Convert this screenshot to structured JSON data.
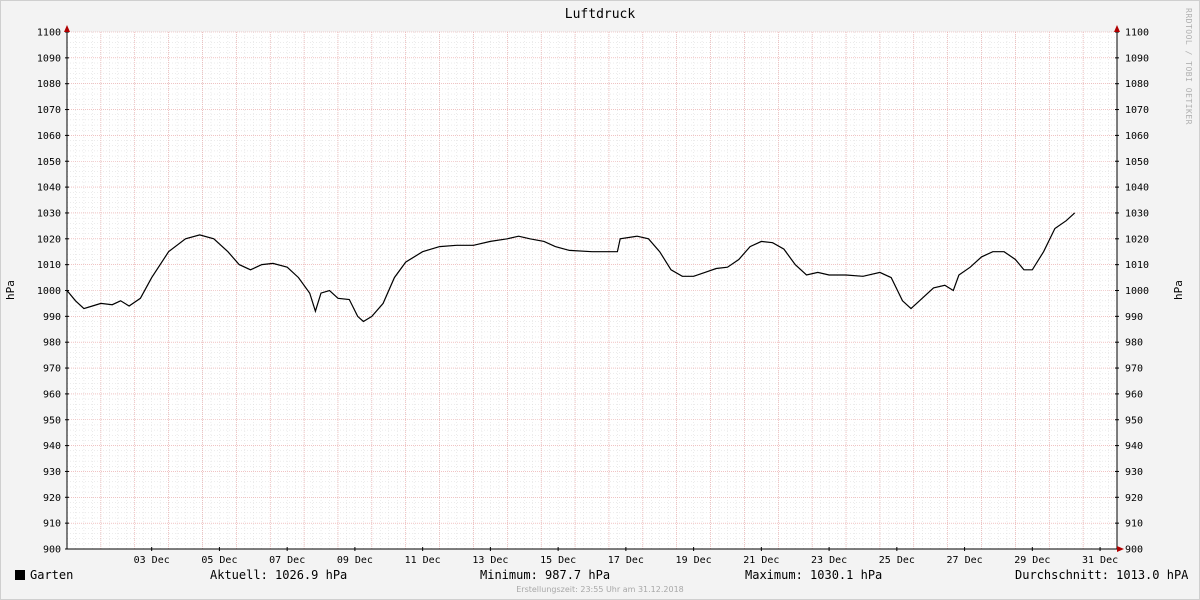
{
  "watermark": "RRDTOOL / TOBI OETIKER",
  "footer": {
    "legend_label": "Garten",
    "legend_color": "#000000",
    "current": "Aktuell: 1026.9 hPa",
    "minimum": "Minimum: 987.7 hPa",
    "maximum": "Maximum: 1030.1 hPa",
    "average": "Durchschnitt: 1013.0 hPA",
    "created": "Erstellungszeit: 23:55 Uhr am 31.12.2018"
  },
  "chart_data": {
    "type": "line",
    "title": "Luftdruck",
    "ylabel": "hPa",
    "ylabel_right": "hPa",
    "xlabel": "",
    "xlim": [
      "2018-12-01",
      "2019-01-01"
    ],
    "ylim": [
      900,
      1100
    ],
    "yticks": [
      900,
      910,
      920,
      930,
      940,
      950,
      960,
      970,
      980,
      990,
      1000,
      1010,
      1020,
      1030,
      1040,
      1050,
      1060,
      1070,
      1080,
      1090,
      1100
    ],
    "xticks": [
      {
        "x": "2018-12-03",
        "label": "03 Dec"
      },
      {
        "x": "2018-12-05",
        "label": "05 Dec"
      },
      {
        "x": "2018-12-07",
        "label": "07 Dec"
      },
      {
        "x": "2018-12-09",
        "label": "09 Dec"
      },
      {
        "x": "2018-12-11",
        "label": "11 Dec"
      },
      {
        "x": "2018-12-13",
        "label": "13 Dec"
      },
      {
        "x": "2018-12-15",
        "label": "15 Dec"
      },
      {
        "x": "2018-12-17",
        "label": "17 Dec"
      },
      {
        "x": "2018-12-19",
        "label": "19 Dec"
      },
      {
        "x": "2018-12-21",
        "label": "21 Dec"
      },
      {
        "x": "2018-12-23",
        "label": "23 Dec"
      },
      {
        "x": "2018-12-25",
        "label": "25 Dec"
      },
      {
        "x": "2018-12-27",
        "label": "27 Dec"
      },
      {
        "x": "2018-12-29",
        "label": "29 Dec"
      },
      {
        "x": "2018-12-31",
        "label": "31 Dec"
      }
    ],
    "grid": true,
    "legend": "bottom-left",
    "colors": {
      "line": "#000000",
      "major_grid": "#e8a0a0",
      "minor_grid": "#d8d8d8",
      "plot_bg": "#ffffff",
      "arrow": "#b00000"
    },
    "series": [
      {
        "name": "Garten",
        "points": [
          [
            "2018-12-01 00:00",
            1000
          ],
          [
            "2018-12-01 06:00",
            996
          ],
          [
            "2018-12-01 12:00",
            993
          ],
          [
            "2018-12-01 18:00",
            994
          ],
          [
            "2018-12-02 00:00",
            995
          ],
          [
            "2018-12-02 08:00",
            994.5
          ],
          [
            "2018-12-02 14:00",
            996
          ],
          [
            "2018-12-02 20:00",
            994
          ],
          [
            "2018-12-03 04:00",
            997
          ],
          [
            "2018-12-03 12:00",
            1005
          ],
          [
            "2018-12-04 00:00",
            1015
          ],
          [
            "2018-12-04 12:00",
            1020
          ],
          [
            "2018-12-04 22:00",
            1021.5
          ],
          [
            "2018-12-05 08:00",
            1020
          ],
          [
            "2018-12-05 18:00",
            1015
          ],
          [
            "2018-12-06 02:00",
            1010
          ],
          [
            "2018-12-06 10:00",
            1008
          ],
          [
            "2018-12-06 18:00",
            1010
          ],
          [
            "2018-12-07 02:00",
            1010.5
          ],
          [
            "2018-12-07 12:00",
            1009
          ],
          [
            "2018-12-07 20:00",
            1005
          ],
          [
            "2018-12-08 04:00",
            999
          ],
          [
            "2018-12-08 08:00",
            992
          ],
          [
            "2018-12-08 12:00",
            999
          ],
          [
            "2018-12-08 18:00",
            1000
          ],
          [
            "2018-12-09 00:00",
            997
          ],
          [
            "2018-12-09 08:00",
            996.5
          ],
          [
            "2018-12-09 14:00",
            990
          ],
          [
            "2018-12-09 18:00",
            988
          ],
          [
            "2018-12-10 00:00",
            990
          ],
          [
            "2018-12-10 08:00",
            995
          ],
          [
            "2018-12-10 16:00",
            1005
          ],
          [
            "2018-12-11 00:00",
            1011
          ],
          [
            "2018-12-11 12:00",
            1015
          ],
          [
            "2018-12-12 00:00",
            1017
          ],
          [
            "2018-12-12 12:00",
            1017.5
          ],
          [
            "2018-12-13 00:00",
            1017.5
          ],
          [
            "2018-12-13 12:00",
            1019
          ],
          [
            "2018-12-14 00:00",
            1020
          ],
          [
            "2018-12-14 08:00",
            1021
          ],
          [
            "2018-12-14 16:00",
            1020
          ],
          [
            "2018-12-15 02:00",
            1019
          ],
          [
            "2018-12-15 10:00",
            1017
          ],
          [
            "2018-12-15 20:00",
            1015.5
          ],
          [
            "2018-12-16 12:00",
            1015
          ],
          [
            "2018-12-17 06:00",
            1015
          ],
          [
            "2018-12-17 08:00",
            1020
          ],
          [
            "2018-12-17 20:00",
            1021
          ],
          [
            "2018-12-18 04:00",
            1020
          ],
          [
            "2018-12-18 12:00",
            1015
          ],
          [
            "2018-12-18 20:00",
            1008
          ],
          [
            "2018-12-19 04:00",
            1005.5
          ],
          [
            "2018-12-19 12:00",
            1005.5
          ],
          [
            "2018-12-19 20:00",
            1007
          ],
          [
            "2018-12-20 04:00",
            1008.5
          ],
          [
            "2018-12-20 12:00",
            1009
          ],
          [
            "2018-12-20 20:00",
            1012
          ],
          [
            "2018-12-21 04:00",
            1017
          ],
          [
            "2018-12-21 12:00",
            1019
          ],
          [
            "2018-12-21 20:00",
            1018.5
          ],
          [
            "2018-12-22 04:00",
            1016
          ],
          [
            "2018-12-22 12:00",
            1010
          ],
          [
            "2018-12-22 20:00",
            1006
          ],
          [
            "2018-12-23 04:00",
            1007
          ],
          [
            "2018-12-23 12:00",
            1006
          ],
          [
            "2018-12-24 00:00",
            1006
          ],
          [
            "2018-12-24 12:00",
            1005.5
          ],
          [
            "2018-12-25 00:00",
            1007
          ],
          [
            "2018-12-25 08:00",
            1005
          ],
          [
            "2018-12-25 16:00",
            996
          ],
          [
            "2018-12-25 22:00",
            993
          ],
          [
            "2018-12-26 06:00",
            997
          ],
          [
            "2018-12-26 14:00",
            1001
          ],
          [
            "2018-12-26 22:00",
            1002
          ],
          [
            "2018-12-27 04:00",
            1000
          ],
          [
            "2018-12-27 08:00",
            1006
          ],
          [
            "2018-12-27 16:00",
            1009
          ],
          [
            "2018-12-28 00:00",
            1013
          ],
          [
            "2018-12-28 08:00",
            1015
          ],
          [
            "2018-12-28 16:00",
            1015
          ],
          [
            "2018-12-29 00:00",
            1012
          ],
          [
            "2018-12-29 06:00",
            1008
          ],
          [
            "2018-12-29 12:00",
            1008
          ],
          [
            "2018-12-29 20:00",
            1015
          ],
          [
            "2018-12-30 04:00",
            1024
          ],
          [
            "2018-12-30 12:00",
            1027
          ],
          [
            "2018-12-30 18:00",
            1030
          ]
        ]
      }
    ]
  }
}
